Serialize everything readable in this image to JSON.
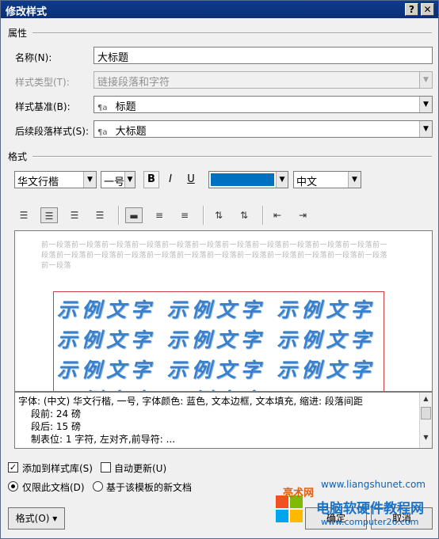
{
  "title": "修改样式",
  "title_buttons": {
    "help": "?",
    "close": "✕"
  },
  "properties": {
    "section": "属性",
    "name_label": "名称(N):",
    "name_value": "大标题",
    "type_label": "样式类型(T):",
    "type_value": "链接段落和字符",
    "based_label": "样式基准(B):",
    "based_value": "标题",
    "next_label": "后续段落样式(S):",
    "next_value": "大标题",
    "para_glyph": "¶a"
  },
  "format": {
    "section": "格式",
    "font": "华文行楷",
    "size": "一号",
    "bold": "B",
    "italic": "I",
    "underline": "U",
    "color_hex": "#0070c0",
    "language": "中文"
  },
  "preview": {
    "prev_text": "前一段落前一段落前一段落前一段落前一段落前一段落前一段落前一段落前一段落前一段落前一段落前一段落前一段落前一段落前一段落前一段落前一段落前一段落前一段落前一段落前一段落前一段落前一段落前一段落",
    "sample_text": "示例文字 示例文字 示例文字 示例文字 示例文字 示例文字 示例文字 示例文字 示例文字 示例文字 示例文字"
  },
  "description": {
    "line1": "字体: (中文) 华文行楷, 一号, 字体颜色: 蓝色, 文本边框, 文本填充, 缩进: 段落间距",
    "line2": "段前: 24 磅",
    "line3": "段后: 15 磅",
    "line4": "制表位: 1 字符, 左对齐,前导符: ..."
  },
  "options": {
    "add_gallery": "添加到样式库(S)",
    "auto_update": "自动更新(U)",
    "this_doc": "仅限此文档(D)",
    "template": "基于该模板的新文档"
  },
  "buttons": {
    "format": "格式(O) ▾",
    "ok": "确定",
    "cancel": "取消"
  },
  "watermark": {
    "w1": "亮术网",
    "w2": "www.liangshunet.com",
    "w3": "电脑软硬件教程网",
    "w4": "www.computer26.com"
  }
}
